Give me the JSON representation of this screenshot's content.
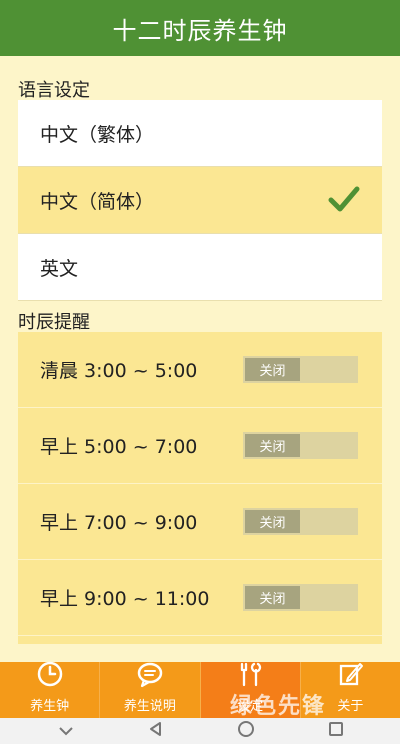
{
  "header": {
    "title": "十二时辰养生钟"
  },
  "language": {
    "section_label": "语言设定",
    "options": [
      {
        "label": "中文（繁体）",
        "selected": false
      },
      {
        "label": "中文（简体）",
        "selected": true
      },
      {
        "label": "英文",
        "selected": false
      }
    ]
  },
  "reminders": {
    "section_label": "时辰提醒",
    "items": [
      {
        "label": "清晨 3:00 ~ 5:00",
        "toggle": "关闭"
      },
      {
        "label": "早上 5:00 ~ 7:00",
        "toggle": "关闭"
      },
      {
        "label": "早上 7:00 ~ 9:00",
        "toggle": "关闭"
      },
      {
        "label": "早上 9:00 ~ 11:00",
        "toggle": "关闭"
      }
    ]
  },
  "tabs": [
    {
      "label": "养生钟",
      "icon": "clock-icon",
      "active": false
    },
    {
      "label": "养生说明",
      "icon": "chat-icon",
      "active": false
    },
    {
      "label": "设定",
      "icon": "tools-icon",
      "active": true
    },
    {
      "label": "关于",
      "icon": "edit-icon",
      "active": false
    }
  ],
  "watermark": "绿色先锋",
  "colors": {
    "header": "#4f9134",
    "highlight": "#fbe793",
    "tabbar": "#f49a19",
    "check": "#4f9134"
  }
}
